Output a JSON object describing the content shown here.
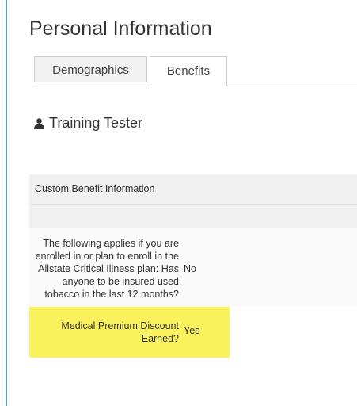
{
  "page": {
    "title": "Personal Information"
  },
  "tabs": [
    {
      "label": "Demographics",
      "active": false
    },
    {
      "label": "Benefits",
      "active": true
    }
  ],
  "user": {
    "name": "Training Tester",
    "icon": "user-icon"
  },
  "benefits": {
    "header": "Custom Benefit Information",
    "rows": [
      {
        "label": "The following applies if you are enrolled in or plan to enroll in the Allstate Critical Illness plan: Has anyone to be insured used tobacco in the last 12 months?",
        "value": "No"
      },
      {
        "label": "Medical Premium Discount Earned?",
        "value": "Yes",
        "highlighted": true
      }
    ]
  },
  "colors": {
    "highlight": "#f9f25c",
    "accent_border": "#5b9bd5"
  }
}
